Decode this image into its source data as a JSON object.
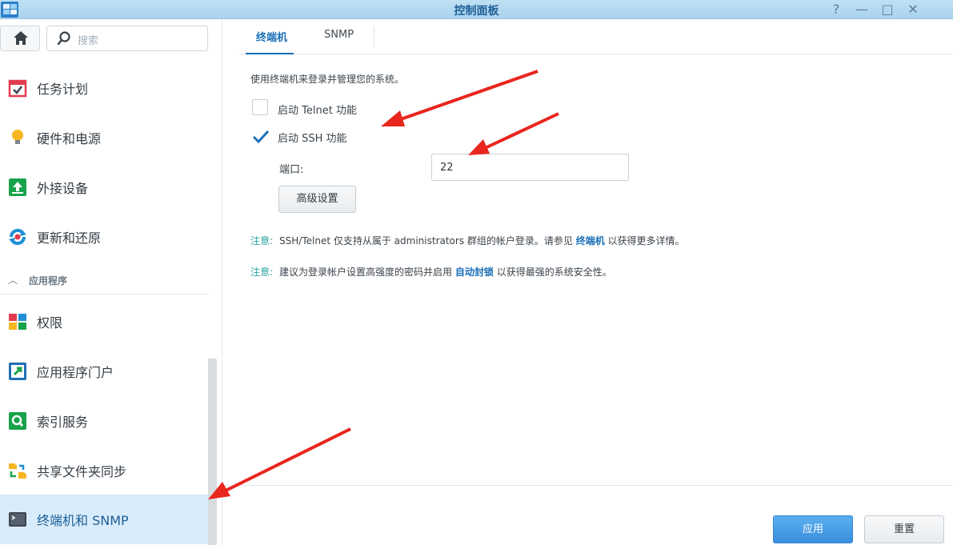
{
  "window": {
    "title": "控制面板",
    "controls": [
      "?",
      "—",
      "□",
      "✕"
    ]
  },
  "sidebar": {
    "search_placeholder": "搜索",
    "items": [
      {
        "label": "任务计划",
        "icon": "calendar-check-icon"
      },
      {
        "label": "硬件和电源",
        "icon": "lightbulb-icon"
      },
      {
        "label": "外接设备",
        "icon": "upload-device-icon"
      },
      {
        "label": "更新和还原",
        "icon": "refresh-icon"
      },
      {
        "label": "权限",
        "icon": "permission-icon"
      },
      {
        "label": "应用程序门户",
        "icon": "portal-icon"
      },
      {
        "label": "索引服务",
        "icon": "index-search-icon"
      },
      {
        "label": "共享文件夹同步",
        "icon": "folder-sync-icon"
      },
      {
        "label": "终端机和 SNMP",
        "icon": "terminal-icon",
        "selected": true
      }
    ],
    "section_label": "应用程序"
  },
  "tabs": [
    {
      "label": "终端机",
      "active": true
    },
    {
      "label": "SNMP",
      "active": false
    }
  ],
  "terminal": {
    "description": "使用终端机来登录并管理您的系统。",
    "telnet_label": "启动 Telnet 功能",
    "telnet_checked": false,
    "ssh_label": "启动 SSH 功能",
    "ssh_checked": true,
    "port_label": "端口:",
    "port_value": "22",
    "advanced_button": "高级设置"
  },
  "notes": [
    {
      "key": "注意:",
      "text_before": "SSH/Telnet 仅支持从属于 administrators 群组的帐户登录。请参见 ",
      "link": "终端机",
      "text_after": " 以获得更多详情。"
    },
    {
      "key": "注意:",
      "text_before": "建议为登录帐户设置高强度的密码并启用 ",
      "link": "自动封锁",
      "text_after": " 以获得最强的系统安全性。"
    }
  ],
  "footer": {
    "apply_label": "应用",
    "reset_label": "重置"
  },
  "colors": {
    "accent": "#1b70b8",
    "selected_bg": "#d9ecfb",
    "annotation_arrow": "#e8261e"
  }
}
